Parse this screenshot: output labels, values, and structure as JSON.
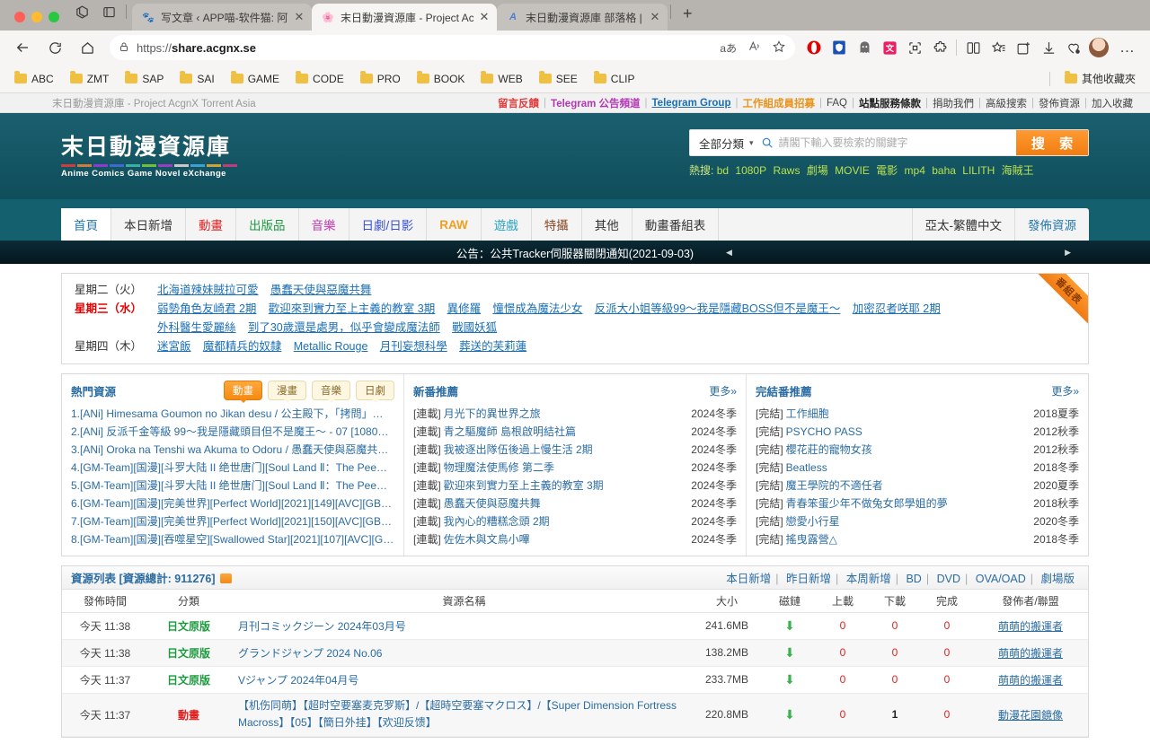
{
  "browser": {
    "tabs": [
      {
        "title": "写文章 ‹ APP喵-软件猫: 阿喵",
        "favicon": "paw-icon",
        "active": false
      },
      {
        "title": "末日動漫資源庫 - Project Acg",
        "favicon": "site-icon",
        "active": true
      },
      {
        "title": "末日動漫資源庫 部落格 | 末日",
        "favicon": "blog-icon",
        "active": false
      }
    ],
    "newtab_label": "+",
    "url_scheme": "https://",
    "url_host": "share.acgnx.se",
    "toolbar_icons": [
      "back-icon",
      "reload-icon",
      "home-icon",
      "lock-icon",
      "translate-icon",
      "read-aloud-icon",
      "favorite-star-icon"
    ],
    "extension_icons": [
      "opera-ext-icon",
      "shield-ext-icon",
      "ghost-ext-icon",
      "translate-ext-icon",
      "capture-icon",
      "puzzle-icon",
      "split-screen-icon",
      "collections-icon",
      "add-ext-icon",
      "downloads-icon",
      "browser-essentials-icon"
    ],
    "bookmarks": [
      "ABC",
      "ZMT",
      "SAP",
      "SAI",
      "GAME",
      "CODE",
      "PRO",
      "BOOK",
      "WEB",
      "SEE",
      "CLIP"
    ],
    "other_bookmarks": "其他收藏夾"
  },
  "topbar": {
    "site_label": "末日動漫資源庫 - Project AcgnX Torrent Asia",
    "links": [
      {
        "text": "留言反饋",
        "color": "#e23c3c",
        "bold": true
      },
      {
        "text": "Telegram 公告頻道",
        "color": "#b536b5",
        "bold": true
      },
      {
        "text": "Telegram Group",
        "color": "#1a6fb5",
        "bold": true,
        "underline": true
      },
      {
        "text": "工作組成員招募",
        "color": "#e8951e",
        "bold": true
      },
      {
        "text": "FAQ",
        "color": "#444",
        "bold": false
      },
      {
        "text": "站點服務條款",
        "color": "#222",
        "bold": true
      },
      {
        "text": "捐助我們",
        "color": "#444",
        "bold": false
      },
      {
        "text": "高級搜索",
        "color": "#444",
        "bold": false
      },
      {
        "text": "發佈資源",
        "color": "#444",
        "bold": false
      },
      {
        "text": "加入收藏",
        "color": "#444",
        "bold": false
      }
    ]
  },
  "header": {
    "logo_zh": "末日動漫資源庫",
    "logo_en": "Anime Comics Game Novel eXchange",
    "search": {
      "category": "全部分類",
      "placeholder": "請閣下輸入要檢索的關鍵字",
      "value": "",
      "button": "搜 索"
    },
    "hot_label": "熱搜:",
    "hot_keywords": [
      "bd",
      "1080P",
      "Raws",
      "劇場",
      "MOVIE",
      "電影",
      "mp4",
      "baha",
      "LILITH",
      "海賊王"
    ]
  },
  "nav": {
    "items": [
      {
        "label": "首頁",
        "color": "#2277aa",
        "active": true
      },
      {
        "label": "本日新增",
        "color": "#333"
      },
      {
        "label": "動畫",
        "color": "#e02020"
      },
      {
        "label": "出版品",
        "color": "#1a9c3c"
      },
      {
        "label": "音樂",
        "color": "#c03bb0"
      },
      {
        "label": "日劇/日影",
        "color": "#3a52d8"
      },
      {
        "label": "RAW",
        "color": "#f0a020"
      },
      {
        "label": "遊戲",
        "color": "#2aa3c0"
      },
      {
        "label": "特攝",
        "color": "#8a4b2a"
      },
      {
        "label": "其他",
        "color": "#333"
      },
      {
        "label": "動畫番組表",
        "color": "#333"
      }
    ],
    "lang": "亞太-繁體中文",
    "publish": "發佈資源"
  },
  "notice": {
    "text": "公告：公共Tracker伺服器關閉通知(2021-09-03)",
    "prev_icon": "triangle-left-icon",
    "next_icon": "triangle-right-icon"
  },
  "schedule": {
    "ribbon": "番組表",
    "rows": [
      {
        "day": "星期二（火）",
        "today": false,
        "links": [
          "北海道辣妹賊拉可愛",
          "愚蠢天使與惡魔共舞"
        ]
      },
      {
        "day": "星期三（水）",
        "today": true,
        "links": [
          "弱勢角色友崎君 2期",
          "歡迎來到實力至上主義的教室 3期",
          "異修羅",
          "憧憬成為魔法少女",
          "反派大小姐等級99～我是隱藏BOSS但不是魔王～",
          "加密忍者咲耶 2期"
        ]
      },
      {
        "day": "",
        "today": false,
        "links": [
          "外科醫生愛麗絲",
          "到了30歲還是處男，似乎會變成魔法師",
          "戰國妖狐"
        ]
      },
      {
        "day": "星期四（木）",
        "today": false,
        "links": [
          "迷宮飯",
          "魔都精兵的奴隸",
          "Metallic Rouge",
          "月刊妄想科學",
          "葬送的芙莉蓮"
        ]
      }
    ]
  },
  "panels": [
    {
      "title": "熱門資源",
      "tabs": [
        {
          "label": "動畫",
          "active": true
        },
        {
          "label": "漫畫",
          "active": false
        },
        {
          "label": "音樂",
          "active": false
        },
        {
          "label": "日劇",
          "active": false
        }
      ],
      "items": [
        {
          "text": "1.[ANi] Himesama Goumon no Jikan desu / 公主殿下，「拷問」…"
        },
        {
          "text": "2.[ANi] 反派千金等級 99～我是隱藏頭目但不是魔王～ - 07 [1080P…"
        },
        {
          "text": "3.[ANi] Oroka na Tenshi wa Akuma to Odoru / 愚蠢天使與惡魔共…"
        },
        {
          "text": "4.[GM-Team][国漫][斗罗大陆 II 绝世唐门][Soul Land Ⅱ：The Pee…"
        },
        {
          "text": "5.[GM-Team][国漫][斗罗大陆 II 绝世唐门][Soul Land Ⅱ：The Pee…"
        },
        {
          "text": "6.[GM-Team][国漫][完美世界][Perfect World][2021][149][AVC][GB][…"
        },
        {
          "text": "7.[GM-Team][国漫][完美世界][Perfect World][2021][150][AVC][GB][…"
        },
        {
          "text": "8.[GM-Team][国漫][吞噬星空][Swallowed Star][2021][107][AVC][G…"
        }
      ]
    },
    {
      "title": "新番推薦",
      "more": "更多»",
      "items": [
        {
          "tag": "[連載]",
          "text": "月光下的異世界之旅",
          "season": "2024冬季"
        },
        {
          "tag": "[連載]",
          "text": "青之驅魔師 島根啟明結社篇",
          "season": "2024冬季"
        },
        {
          "tag": "[連載]",
          "text": "我被逐出隊伍後過上慢生活 2期",
          "season": "2024冬季"
        },
        {
          "tag": "[連載]",
          "text": "物理魔法使馬修 第二季",
          "season": "2024冬季"
        },
        {
          "tag": "[連載]",
          "text": "歡迎來到實力至上主義的教室 3期",
          "season": "2024冬季"
        },
        {
          "tag": "[連載]",
          "text": "愚蠢天使與惡魔共舞",
          "season": "2024冬季"
        },
        {
          "tag": "[連載]",
          "text": "我內心的糟糕念頭 2期",
          "season": "2024冬季"
        },
        {
          "tag": "[連載]",
          "text": "佐佐木與文鳥小嗶",
          "season": "2024冬季"
        }
      ]
    },
    {
      "title": "完結番推薦",
      "more": "更多»",
      "items": [
        {
          "tag": "[完結]",
          "text": "工作細胞",
          "season": "2018夏季"
        },
        {
          "tag": "[完結]",
          "text": "PSYCHO PASS",
          "season": "2012秋季"
        },
        {
          "tag": "[完結]",
          "text": "櫻花莊的寵物女孩",
          "season": "2012秋季"
        },
        {
          "tag": "[完結]",
          "text": "Beatless",
          "season": "2018冬季"
        },
        {
          "tag": "[完結]",
          "text": "魔王學院的不適任者",
          "season": "2020夏季"
        },
        {
          "tag": "[完結]",
          "text": "青春笨蛋少年不做兔女郎學姐的夢",
          "season": "2018秋季"
        },
        {
          "tag": "[完結]",
          "text": "戀愛小行星",
          "season": "2020冬季"
        },
        {
          "tag": "[完結]",
          "text": "搖曳露營△",
          "season": "2018冬季"
        }
      ]
    }
  ],
  "reslist": {
    "title_prefix": "資源列表 [資源總計: ",
    "total": "911276",
    "title_suffix": "]",
    "rss_icon": "rss-icon",
    "quick_links": [
      "本日新增",
      "昨日新增",
      "本周新增",
      "BD",
      "DVD",
      "OVA/OAD",
      "劇場版"
    ],
    "columns": [
      "發佈時間",
      "分類",
      "資源名稱",
      "大小",
      "磁鏈",
      "上載",
      "下載",
      "完成",
      "發佈者/聯盟"
    ],
    "rows": [
      {
        "time": "今天 11:38",
        "cat": "日文原版",
        "cat_type": "jp",
        "name": "月刊コミックジーン 2024年03月号",
        "size": "241.6MB",
        "magnet": "download-icon",
        "up": "0",
        "down": "0",
        "done": "0",
        "publisher": "萌萌的搬運者"
      },
      {
        "time": "今天 11:38",
        "cat": "日文原版",
        "cat_type": "jp",
        "name": "グランドジャンプ 2024 No.06",
        "size": "138.2MB",
        "magnet": "download-icon",
        "up": "0",
        "down": "0",
        "done": "0",
        "publisher": "萌萌的搬運者"
      },
      {
        "time": "今天 11:37",
        "cat": "日文原版",
        "cat_type": "jp",
        "name": "Vジャンプ 2024年04月号",
        "size": "233.7MB",
        "magnet": "download-icon",
        "up": "0",
        "down": "0",
        "done": "0",
        "publisher": "萌萌的搬運者"
      },
      {
        "time": "今天 11:37",
        "cat": "動畫",
        "cat_type": "anime",
        "name": "【机伤同萌】【超时空要塞麦克罗斯】/【超時空要塞マクロス】/【Super Dimension Fortress Macross】【05】【簡日外挂】【欢迎反馈】",
        "size": "220.8MB",
        "magnet": "download-icon",
        "up": "0",
        "down": "1",
        "done": "0",
        "publisher": "動漫花園鏡像"
      }
    ]
  }
}
